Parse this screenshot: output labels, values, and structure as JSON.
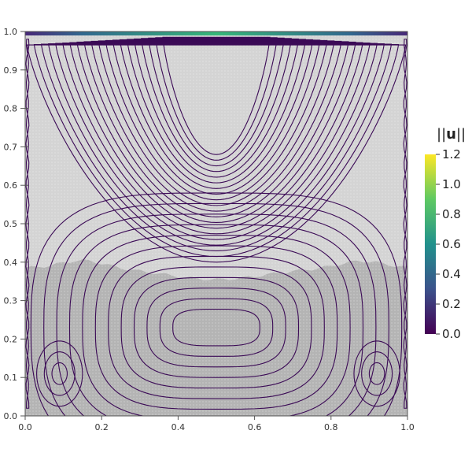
{
  "chart_data": {
    "type": "contour",
    "xlim": [
      0.0,
      1.0
    ],
    "ylim": [
      0.0,
      1.0
    ],
    "x_ticks": [
      "0.0",
      "0.2",
      "0.4",
      "0.6",
      "0.8",
      "1.0"
    ],
    "y_ticks": [
      "0.0",
      "0.1",
      "0.2",
      "0.3",
      "0.4",
      "0.5",
      "0.6",
      "0.7",
      "0.8",
      "0.9",
      "1.0"
    ],
    "x_tick_values": [
      0.0,
      0.2,
      0.4,
      0.6,
      0.8,
      1.0
    ],
    "y_tick_values": [
      0.0,
      0.1,
      0.2,
      0.3,
      0.4,
      0.5,
      0.6,
      0.7,
      0.8,
      0.9,
      1.0
    ],
    "colorbar": {
      "title_prefix": "||",
      "title_main": "u",
      "title_suffix": "||",
      "range": [
        0.0,
        1.2
      ],
      "ticks": [
        "1.2",
        "1.0",
        "0.8",
        "0.6",
        "0.4",
        "0.2",
        "0.0"
      ],
      "tick_values": [
        1.2,
        1.0,
        0.8,
        0.6,
        0.4,
        0.2,
        0.0
      ],
      "colormap": [
        "#440154",
        "#3b528b",
        "#21918c",
        "#5ec962",
        "#fde725"
      ]
    },
    "upper_phase_color": "#d4d4d4",
    "lower_phase_color": "#b4b4b4",
    "interface_y": 0.385,
    "upper_vortex_center": [
      0.5,
      0.82
    ],
    "lower_vortex_center": [
      0.5,
      0.25
    ],
    "corner_vortex_centers": [
      [
        0.09,
        0.11
      ],
      [
        0.92,
        0.11
      ]
    ],
    "streamline_color": "#3b0a56",
    "lid_velocity": 1.0
  }
}
